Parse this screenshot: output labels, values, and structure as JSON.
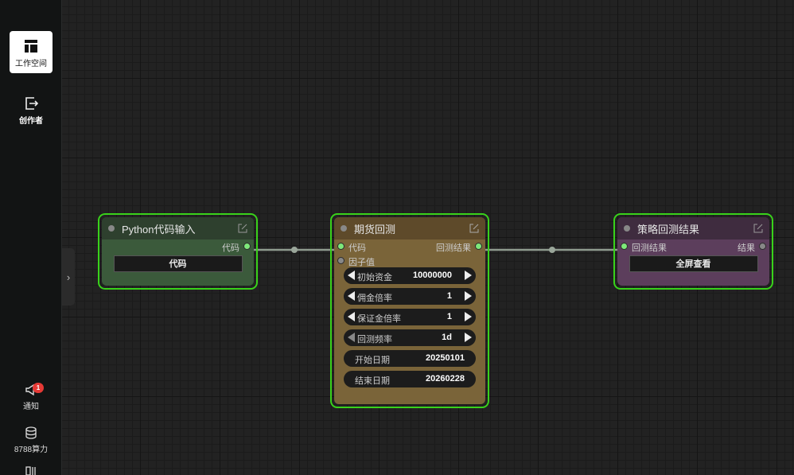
{
  "sidebar": {
    "workspace_label": "工作空间",
    "creator_label": "创作者",
    "notify_label": "通知",
    "notify_badge": "1",
    "compute_label": "8788算力"
  },
  "colors": {
    "accent_border": "#39d21b",
    "port_active": "#7ee87a",
    "node_python_bg": "#3b5a3b",
    "node_backtest_bg": "#7a6439",
    "node_result_bg": "#5c3e5c"
  },
  "nodes": {
    "python_input": {
      "title": "Python代码输入",
      "output_label": "代码",
      "button_label": "代码"
    },
    "futures_backtest": {
      "title": "期货回测",
      "input_code": "代码",
      "input_factor": "因子值",
      "output_result": "回测结果",
      "widgets": [
        {
          "label": "初始资金",
          "value": "10000000"
        },
        {
          "label": "佣金倍率",
          "value": "1"
        },
        {
          "label": "保证金倍率",
          "value": "1"
        },
        {
          "label": "回测频率",
          "value": "1d"
        }
      ],
      "start_date_label": "开始日期",
      "start_date_value": "20250101",
      "end_date_label": "结束日期",
      "end_date_value": "20260228"
    },
    "strategy_result": {
      "title": "策略回测结果",
      "input_label": "回测结果",
      "output_label": "结果",
      "button_label": "全屏查看"
    }
  }
}
